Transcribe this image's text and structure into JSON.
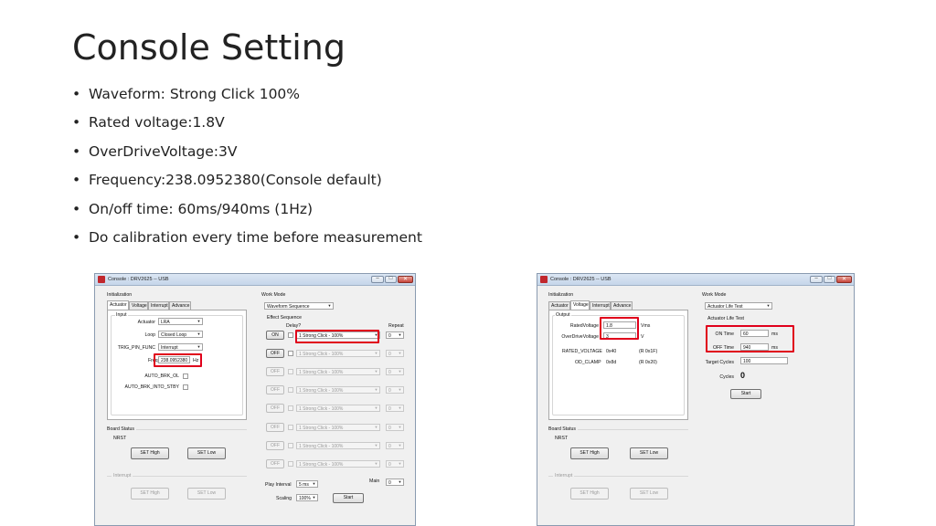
{
  "slide": {
    "title": "Console Setting",
    "bullets": [
      "Waveform: Strong Click 100%",
      "Rated voltage:1.8V",
      "OverDriveVoltage:3V",
      "Frequency:238.0952380(Console default)",
      "On/off time: 60ms/940ms (1Hz)",
      "Do calibration every time before measurement"
    ]
  },
  "left_window": {
    "title": "Console : DRV2625 -- USB",
    "init_label": "Initialization",
    "tabs": [
      "Actuator",
      "Voltage",
      "Interrupt",
      "Advance"
    ],
    "input_group": "Input",
    "actuator_label": "Actuator",
    "actuator_value": "LRA",
    "loop_label": "Loop",
    "loop_value": "Closed Loop",
    "trig_label": "TRIG_PIN_FUNC",
    "trig_value": "Interrupt",
    "freq_label": "Freq",
    "freq_value": "238.0952380",
    "freq_unit": "Hz",
    "auto_brk_ol": "AUTO_BRK_OL",
    "auto_brk_stby": "AUTO_BRK_INTO_STBY",
    "board_status": "Board Status",
    "nrst": "NRST",
    "set_high": "SET High",
    "set_low": "SET Low",
    "interrupt_label": "Interrupt",
    "int_set_high": "SET High",
    "int_set_low": "SET Low",
    "work_mode_label": "Work Mode",
    "work_mode_value": "Waveform Sequence",
    "effect_seq": "Effect Sequence",
    "delay_label": "Delay?",
    "repeat_label": "Repeat",
    "seq_rows": [
      {
        "button": "ON",
        "effect": "1 Strong Click - 100%",
        "repeat": "0"
      },
      {
        "button": "OFF",
        "effect": "1 Strong Click - 100%",
        "repeat": "0"
      },
      {
        "button": "OFF",
        "effect": "1 Strong Click - 100%",
        "repeat": "0"
      },
      {
        "button": "OFF",
        "effect": "1 Strong Click - 100%",
        "repeat": "0"
      },
      {
        "button": "OFF",
        "effect": "1 Strong Click - 100%",
        "repeat": "0"
      },
      {
        "button": "OFF",
        "effect": "1 Strong Click - 100%",
        "repeat": "0"
      },
      {
        "button": "OFF",
        "effect": "1 Strong Click - 100%",
        "repeat": "0"
      },
      {
        "button": "OFF",
        "effect": "1 Strong Click - 100%",
        "repeat": "0"
      }
    ],
    "play_interval_label": "Play Interval",
    "play_interval_value": "5 ms",
    "main_label": "Main",
    "main_value": "0",
    "scaling_label": "Scaling",
    "scaling_value": "100%",
    "start": "Start"
  },
  "right_window": {
    "title": "Console : DRV2625 -- USB",
    "init_label": "Initialization",
    "tabs": [
      "Actuator",
      "Voltage",
      "Interrupt",
      "Advance"
    ],
    "output_group": "Output",
    "rated_voltage_label": "RatedVoltage",
    "rated_voltage_value": "1.8",
    "rated_voltage_unit": "Vms",
    "overdrive_label": "OverDriveVoltage",
    "overdrive_value": "3",
    "overdrive_unit": "V",
    "rated_reg_label": "RATED_VOLTAGE",
    "rated_reg_value": "0x40",
    "rated_reg_addr": "(R 0x1F)",
    "od_clamp_label": "OD_CLAMP",
    "od_clamp_value": "0x8d",
    "od_clamp_addr": "(R 0x20)",
    "board_status": "Board Status",
    "nrst": "NRST",
    "set_high": "SET High",
    "set_low": "SET Low",
    "interrupt_label": "Interrupt",
    "int_set_high": "SET High",
    "int_set_low": "SET Low",
    "work_mode_label": "Work Mode",
    "work_mode_value": "Actuator Life Test",
    "life_test_label": "Actuator Life Test",
    "on_time_label": "ON Time",
    "on_time_value": "60",
    "on_time_unit": "ms",
    "off_time_label": "OFF Time",
    "off_time_value": "940",
    "off_time_unit": "ms",
    "target_cycles_label": "Target Cycles",
    "target_cycles_value": "100",
    "cycles_label": "Cycles",
    "cycles_value": "0",
    "start": "Start"
  }
}
